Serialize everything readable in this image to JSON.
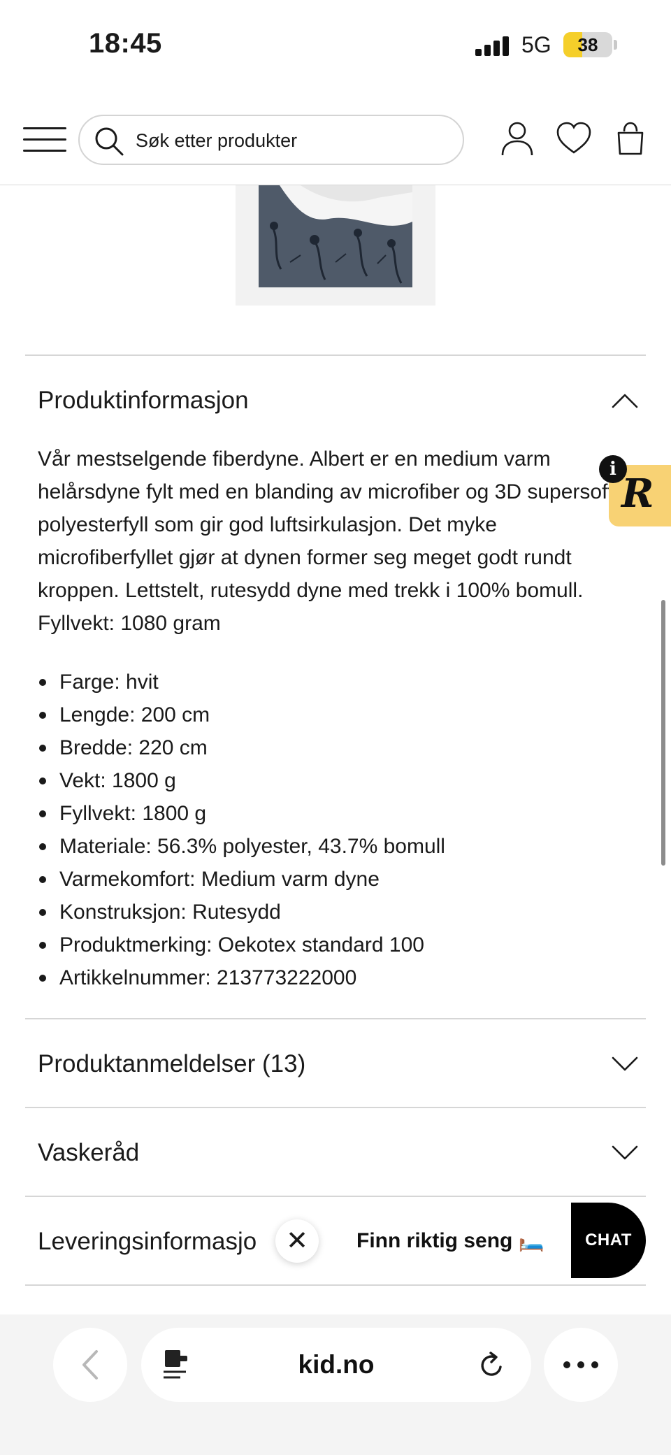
{
  "status_bar": {
    "time": "18:45",
    "network": "5G",
    "battery_level": "38",
    "battery_fraction": 0.38
  },
  "header": {
    "search_placeholder": "Søk etter produkter",
    "icons": [
      "menu-icon",
      "search-icon",
      "user-icon",
      "heart-icon",
      "bag-icon"
    ]
  },
  "accordion": {
    "product_info_title": "Produktinformasjon",
    "description": "Vår mestselgende fiberdyne. Albert er en medium varm helårsdyne fylt med en blanding av microfiber og 3D supersoft polyesterfyll som gir god luftsirkulasjon. Det myke microfiberfyllet gjør at dynen former seg meget godt rundt kroppen. Lettstelt, rutesydd dyne med trekk i 100% bomull. Fyllvekt: 1080 gram",
    "specs": [
      "Farge: hvit",
      "Lengde: 200 cm",
      "Bredde: 220 cm",
      "Vekt: 1800 g",
      "Fyllvekt: 1800 g",
      "Materiale: 56.3% polyester, 43.7% bomull",
      "Varmekomfort: Medium varm dyne",
      "Konstruksjon: Rutesydd",
      "Produktmerking: Oekotex standard 100",
      "Artikkelnummer: 213773222000"
    ],
    "reviews_title": "Produktanmeldelser (13)",
    "washing_title": "Vaskeråd",
    "delivery_title": "Leveringsinformasjo"
  },
  "widgets": {
    "badge_letter": "R",
    "info_glyph": "i",
    "close_glyph": "✕",
    "promo_text": "Finn riktig seng 🛏️",
    "chat_label": "CHAT"
  },
  "browser": {
    "url": "kid.no"
  },
  "colors": {
    "badge_yellow": "#f8d274",
    "battery_yellow": "#f5cf2a",
    "chat_black": "#000000"
  }
}
